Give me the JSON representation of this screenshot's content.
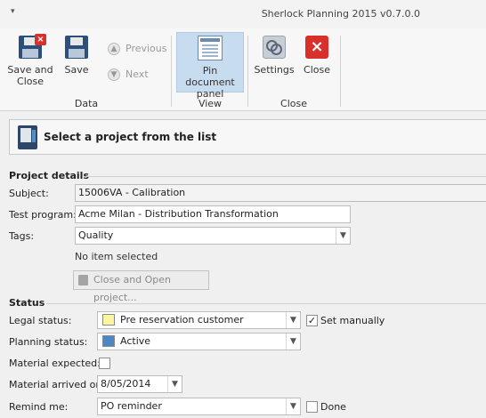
{
  "window": {
    "title": "Sherlock Planning 2015 v0.7.0.0",
    "menu_glyph": "▾"
  },
  "ribbon": {
    "save_and_close_label": "Save and Close",
    "save_label": "Save",
    "previous_label": "Previous",
    "next_label": "Next",
    "pin_label": "Pin document panel",
    "settings_label": "Settings",
    "close_label": "Close",
    "groups": {
      "data": "Data",
      "view": "View",
      "close": "Close"
    }
  },
  "project_bar": {
    "text": "Select a project from the list"
  },
  "project_details": {
    "heading": "Project details",
    "subject_label": "Subject:",
    "subject_value": "15006VA - Calibration",
    "test_program_label": "Test program:",
    "test_program_value": "Acme Milan - Distribution Transformation",
    "tags_label": "Tags:",
    "tags_value": "Quality",
    "no_item_text": "No item selected",
    "close_open_label": "Close and Open project..."
  },
  "status": {
    "heading": "Status",
    "legal_label": "Legal status:",
    "legal_value": "Pre reservation customer",
    "legal_color": "#fbf7a0",
    "set_manually_label": "Set manually",
    "set_manually_checked": true,
    "planning_label": "Planning status:",
    "planning_value": "Active",
    "planning_color": "#4f86c6",
    "material_expected_label": "Material expected:",
    "material_expected_checked": false,
    "material_arrived_label": "Material arrived on:",
    "material_arrived_value": "8/05/2014",
    "remind_label": "Remind me:",
    "remind_value": "PO reminder",
    "done_label": "Done",
    "done_checked": false
  }
}
